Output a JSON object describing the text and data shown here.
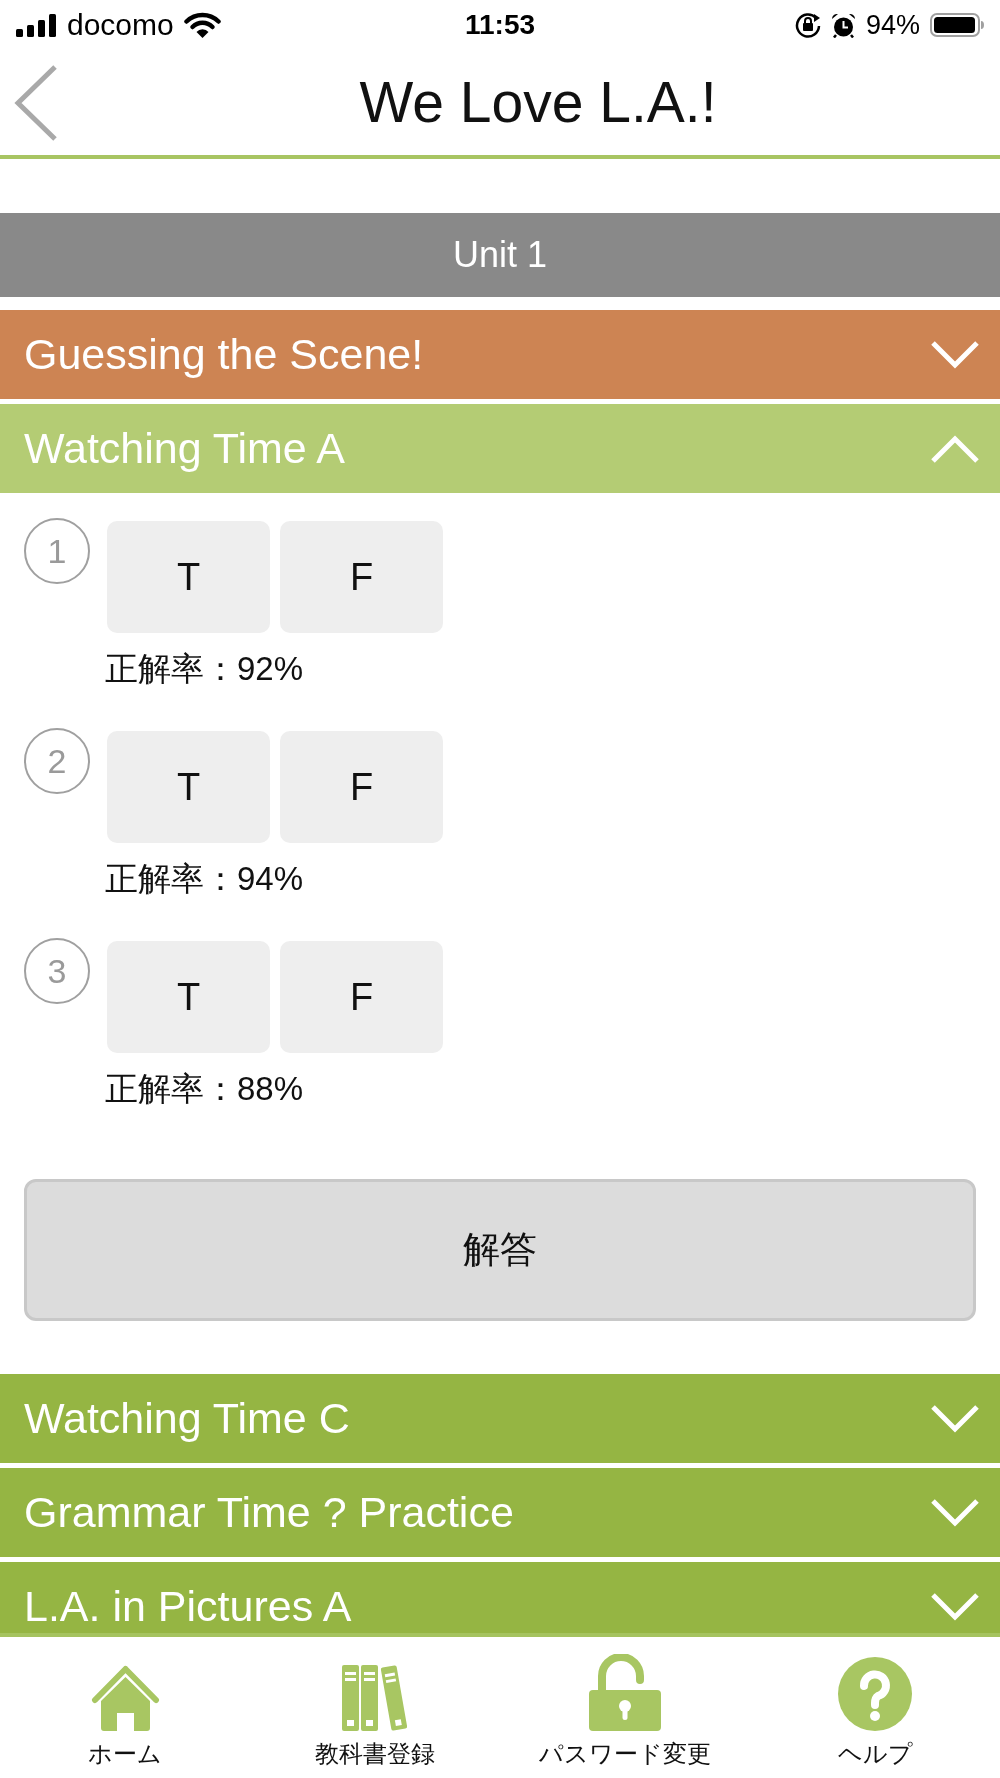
{
  "status_bar": {
    "carrier": "docomo",
    "time": "11:53",
    "battery": "94%"
  },
  "header": {
    "title": "We Love L.A.!"
  },
  "unit": {
    "title": "Unit 1"
  },
  "sections": [
    {
      "title": "Guessing the Scene!",
      "expanded": false,
      "color": "#cd8453"
    },
    {
      "title": "Watching Time A",
      "expanded": true,
      "color": "#b4cc74",
      "questions": [
        {
          "number": "1",
          "options": [
            "T",
            "F"
          ],
          "rate": "正解率：92%"
        },
        {
          "number": "2",
          "options": [
            "T",
            "F"
          ],
          "rate": "正解率：94%"
        },
        {
          "number": "3",
          "options": [
            "T",
            "F"
          ],
          "rate": "正解率：88%"
        }
      ],
      "answer_button": "解答"
    },
    {
      "title": "Watching Time C",
      "expanded": false,
      "color": "#95b543"
    },
    {
      "title": "Grammar Time ? Practice",
      "expanded": false,
      "color": "#95b543"
    },
    {
      "title": "L.A. in Pictures A",
      "expanded": false,
      "color": "#95b543"
    }
  ],
  "tab_bar": [
    {
      "label": "ホーム"
    },
    {
      "label": "教科書登録"
    },
    {
      "label": "パスワード変更"
    },
    {
      "label": "ヘルプ"
    }
  ]
}
